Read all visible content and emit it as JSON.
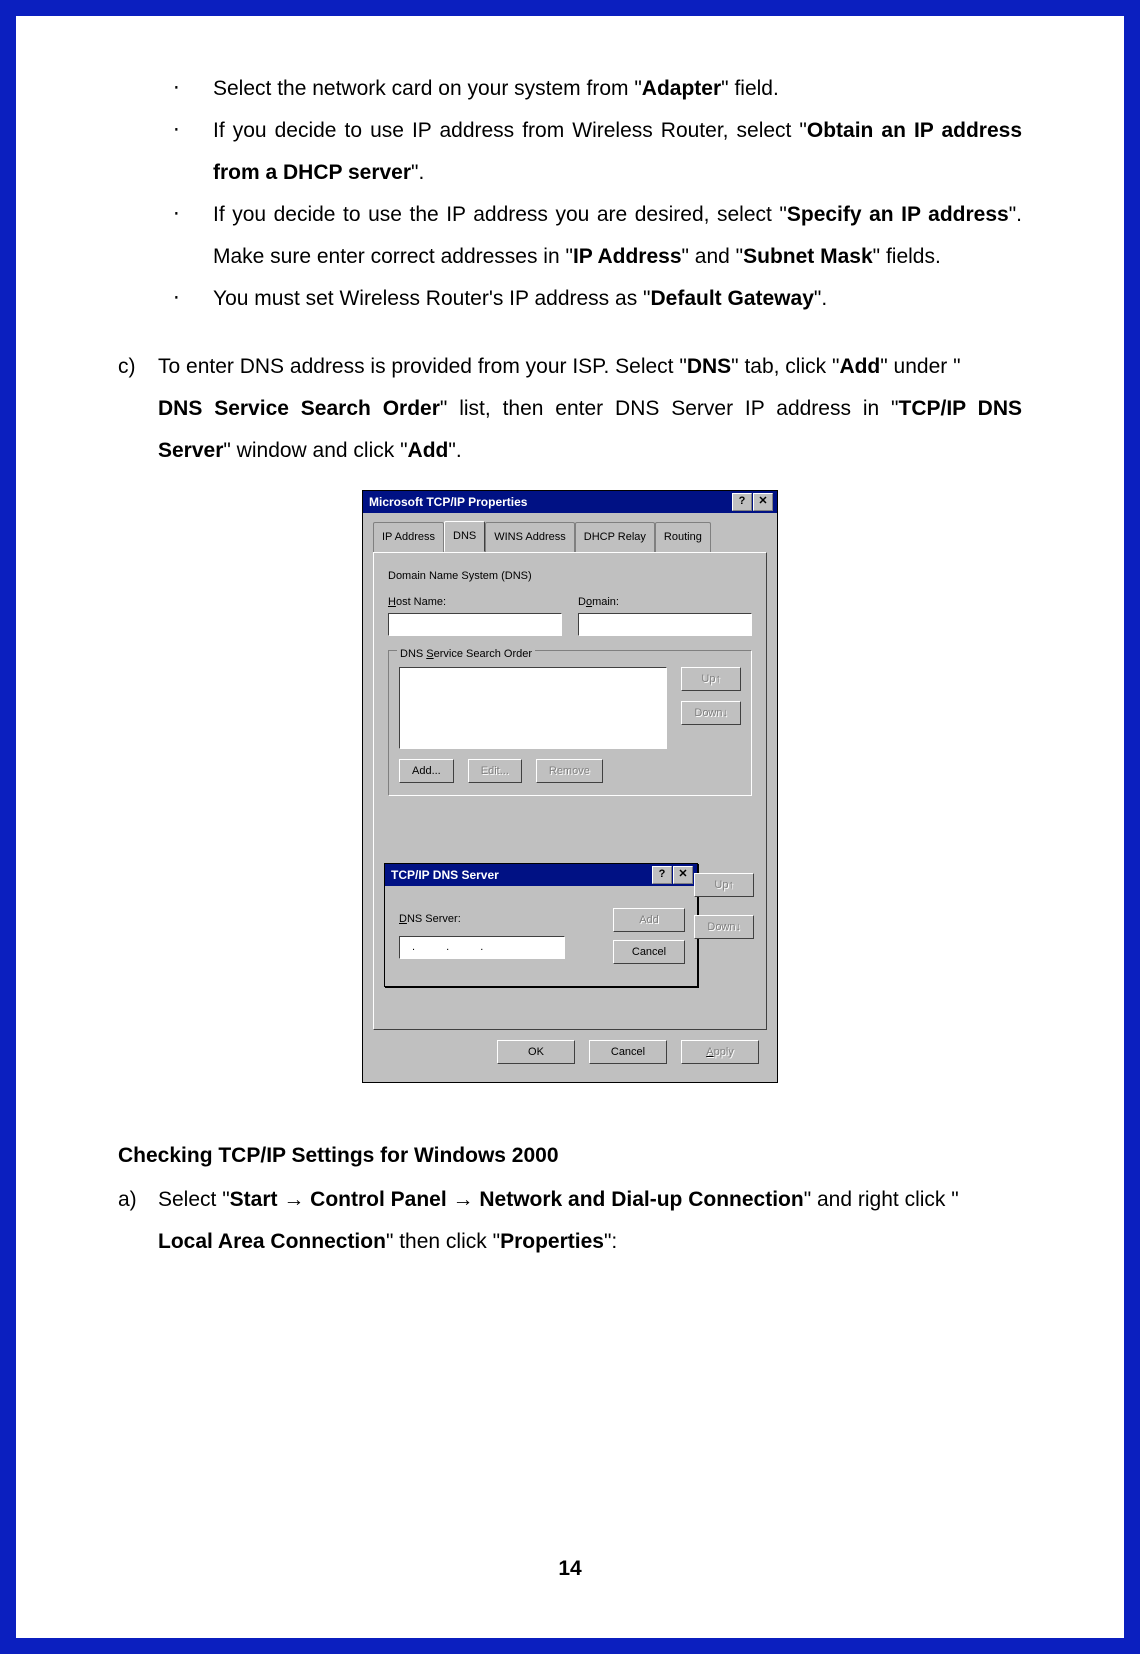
{
  "bullets": {
    "b1_pre": "Select the network card on your system from \"",
    "b1_bold": "Adapter",
    "b1_post": "\" field.",
    "b2_pre": "If you decide to use IP address from Wireless Router, select \"",
    "b2_bold": "Obtain an IP address from a DHCP server",
    "b2_post": "\".",
    "b3_pre": "If you decide to use the IP address you are desired, select \"",
    "b3_bold1": "Specify an IP address",
    "b3_mid1": "\".   Make sure enter correct addresses in \"",
    "b3_bold2": "IP Address",
    "b3_mid2": "\" and \"",
    "b3_bold3": "Subnet Mask",
    "b3_post": "\" fields.",
    "b4_pre": "You must set Wireless Router's IP address as \"",
    "b4_bold": "Default Gateway",
    "b4_post": "\"."
  },
  "c_item": {
    "marker": "c)",
    "pre": "To enter DNS address is provided from your ISP.  Select \"",
    "bold1": "DNS",
    "mid1": "\" tab, click \"",
    "bold2": "Add",
    "mid2": "\" under \"",
    "bold3": "DNS Service Search Order",
    "mid3": "\" list, then enter DNS Server IP address in \"",
    "bold4": "TCP/IP DNS Server",
    "mid4": "\" window and click \"",
    "bold5": "Add",
    "post": "\"."
  },
  "dialog": {
    "title": "Microsoft TCP/IP Properties",
    "help_glyph": "?",
    "close_glyph": "✕",
    "tabs": [
      "IP Address",
      "DNS",
      "WINS Address",
      "DHCP Relay",
      "Routing"
    ],
    "active_tab": 1,
    "section_label": "Domain Name System (DNS)",
    "host_label": "Host Name:",
    "host_u": "H",
    "domain_label": "Domain:",
    "domain_u": "o",
    "group1": "DNS Service Search Order",
    "group1_u": "S",
    "btn_add": "Add...",
    "btn_edit": "Edit...",
    "btn_remove": "Remove",
    "btn_up": "Up↑",
    "btn_down": "Down↓",
    "btn_ok": "OK",
    "btn_cancel": "Cancel",
    "btn_apply": "Apply",
    "apply_u": "A"
  },
  "subdialog": {
    "title": "TCP/IP DNS Server",
    "label": "DNS Server:",
    "label_u": "D",
    "ip_dots": ".   .   .",
    "btn_add": "Add",
    "btn_cancel": "Cancel"
  },
  "heading2": "Checking TCP/IP Settings for Windows 2000",
  "a_item": {
    "marker": "a)",
    "pre": "Select \"",
    "bold1": "Start ",
    "arrow": "→",
    "bold2": " Control Panel ",
    "bold3": " Network and Dial-up Connection",
    "mid1": "\" and right click \"",
    "bold4": "Local Area Connection",
    "mid2": "\" then click \"",
    "bold5": "Properties",
    "post": "\":"
  },
  "page_number": "14"
}
